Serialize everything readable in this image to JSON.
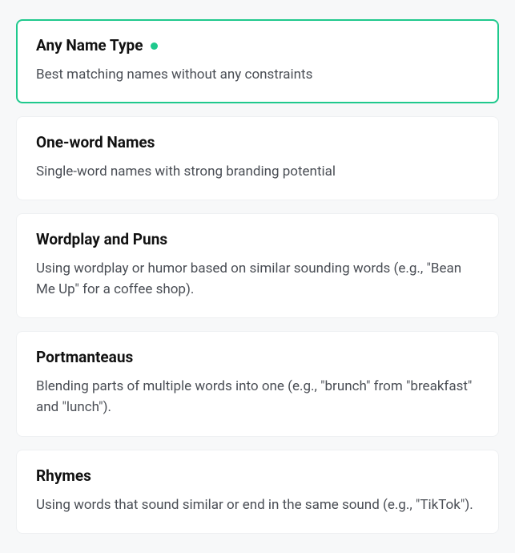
{
  "options": [
    {
      "title": "Any Name Type",
      "description": "Best matching names without any constraints",
      "selected": true
    },
    {
      "title": "One-word Names",
      "description": "Single-word names with strong branding potential",
      "selected": false
    },
    {
      "title": "Wordplay and Puns",
      "description": "Using wordplay or humor based on similar sounding words (e.g., \"Bean Me Up\" for a coffee shop).",
      "selected": false
    },
    {
      "title": "Portmanteaus",
      "description": "Blending parts of multiple words into one (e.g., \"brunch\" from \"breakfast\" and \"lunch\").",
      "selected": false
    },
    {
      "title": "Rhymes",
      "description": "Using words that sound similar or end in the same sound (e.g., \"TikTok\").",
      "selected": false
    }
  ]
}
